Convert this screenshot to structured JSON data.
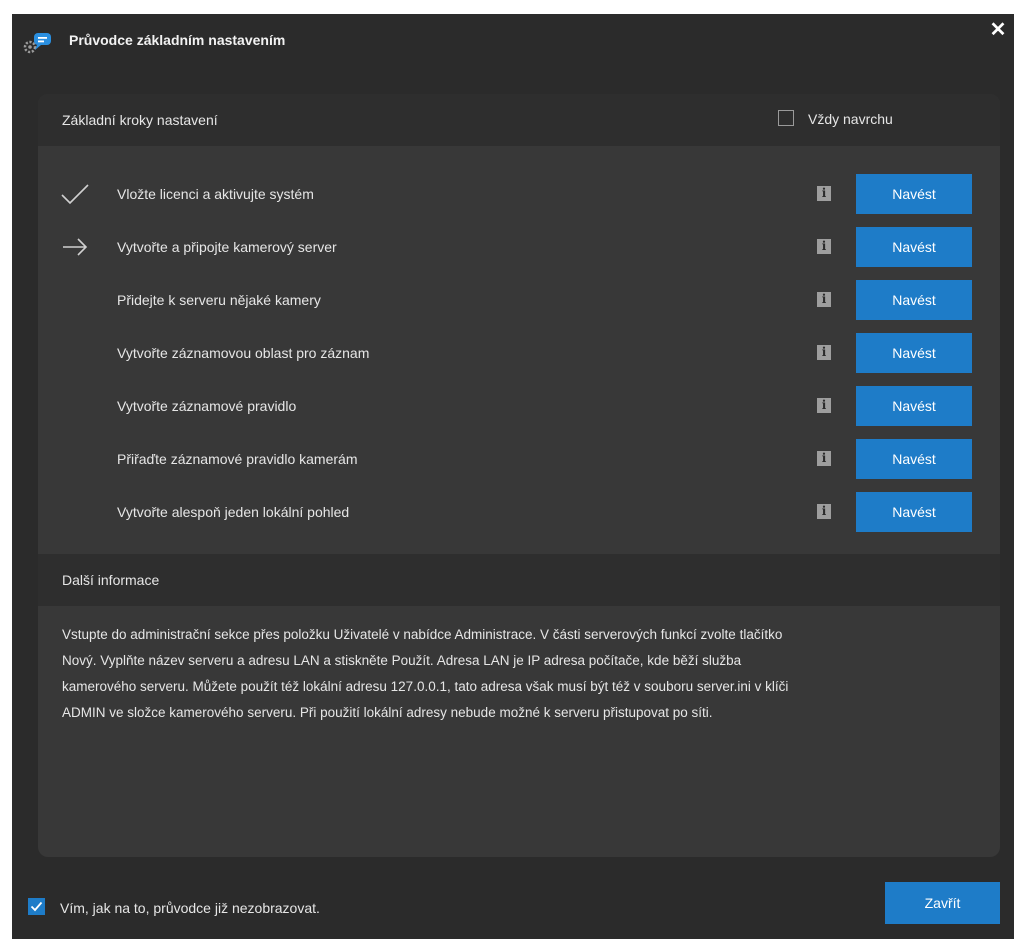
{
  "window": {
    "title": "Průvodce základním nastavením",
    "close_glyph": "✕"
  },
  "setup": {
    "heading": "Základní kroky nastavení",
    "always_on_top": {
      "label": "Vždy navrchu",
      "checked": false
    },
    "steps": [
      {
        "label": "Vložte licenci a aktivujte systém",
        "status": "done",
        "icon": "checkmark-icon",
        "button": "Navést"
      },
      {
        "label": "Vytvořte a připojte kamerový server",
        "status": "current",
        "icon": "arrow-right-icon",
        "button": "Navést"
      },
      {
        "label": "Přidejte k serveru nějaké kamery",
        "status": "pending",
        "icon": "",
        "button": "Navést"
      },
      {
        "label": "Vytvořte záznamovou oblast pro záznam",
        "status": "pending",
        "icon": "",
        "button": "Navést"
      },
      {
        "label": "Vytvořte záznamové pravidlo",
        "status": "pending",
        "icon": "",
        "button": "Navést"
      },
      {
        "label": "Přiřaďte záznamové pravidlo kamerám",
        "status": "pending",
        "icon": "",
        "button": "Navést"
      },
      {
        "label": "Vytvořte alespoň jeden lokální pohled",
        "status": "pending",
        "icon": "",
        "button": "Navést"
      }
    ],
    "info_glyph": "i"
  },
  "more_info": {
    "heading": "Další informace",
    "lines": [
      "Vstupte do administrační sekce přes položku Uživatelé v nabídce Administrace. V části serverových funkcí zvolte tlačítko",
      "Nový. Vyplňte název serveru a adresu LAN a stiskněte Použít. Adresa LAN je IP adresa počítače, kde běží služba",
      "kamerového serveru. Můžete použít též lokální adresu 127.0.0.1, tato adresa však musí být též v souboru server.ini v klíči",
      "ADMIN ve složce kamerového serveru. Při použití lokální adresy nebude možné k serveru přistupovat po síti."
    ]
  },
  "footer": {
    "dont_show": {
      "label": "Vím, jak na to, průvodce již nezobrazovat.",
      "checked": true
    },
    "close_label": "Zavřít"
  },
  "colors": {
    "accent": "#1e7cc8",
    "window_bg": "#2b2b2b",
    "panel_bg": "#383838",
    "section_bg": "#2e2e2e"
  }
}
